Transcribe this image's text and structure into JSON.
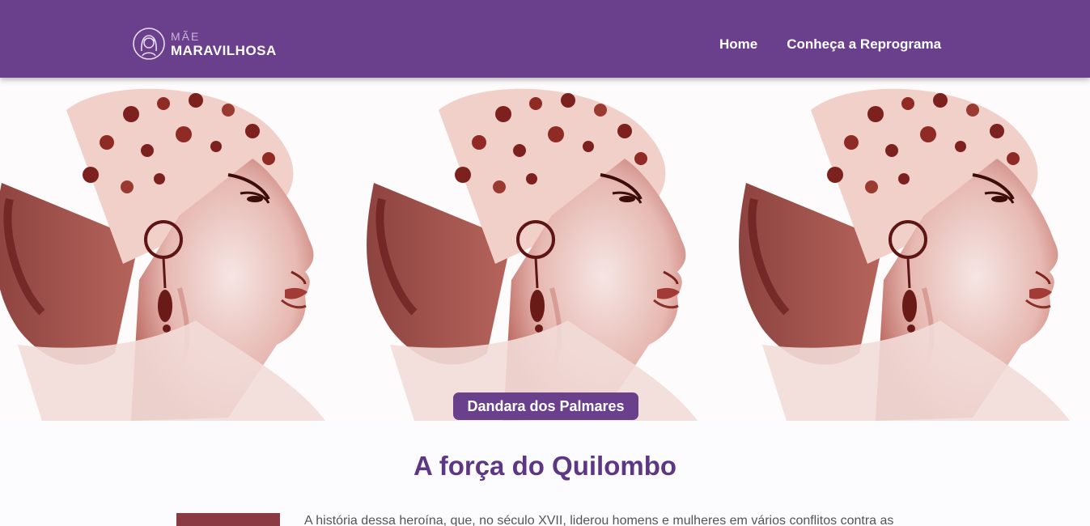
{
  "brand": {
    "top": "MÃE",
    "bottom": "MARAVILHOSA"
  },
  "nav": {
    "items": [
      {
        "label": "Home"
      },
      {
        "label": "Conheça a Reprograma"
      }
    ]
  },
  "hero": {
    "name_badge": "Dandara dos Palmares"
  },
  "main": {
    "title": "A força do Quilombo",
    "paragraph": "A história dessa heroína, que, no século XVII, liderou homens e mulheres em vários conflitos contra as"
  },
  "colors": {
    "primary": "#6a3f8c",
    "title": "#5e3784",
    "ink": "#8a2f2a"
  }
}
